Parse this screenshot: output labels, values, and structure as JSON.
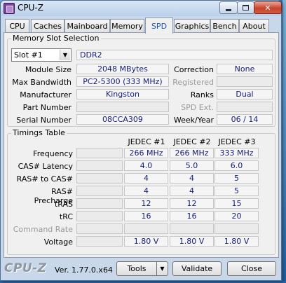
{
  "window": {
    "title": "CPU-Z"
  },
  "tabs": [
    {
      "label": "CPU"
    },
    {
      "label": "Caches"
    },
    {
      "label": "Mainboard"
    },
    {
      "label": "Memory"
    },
    {
      "label": "SPD"
    },
    {
      "label": "Graphics"
    },
    {
      "label": "Bench"
    },
    {
      "label": "About"
    }
  ],
  "active_tab": "SPD",
  "slot": {
    "group_title": "Memory Slot Selection",
    "selected": "Slot #1",
    "type": "DDR2",
    "labels": {
      "module_size": "Module Size",
      "max_bandwidth": "Max Bandwidth",
      "manufacturer": "Manufacturer",
      "part_number": "Part Number",
      "serial_number": "Serial Number",
      "correction": "Correction",
      "registered": "Registered",
      "ranks": "Ranks",
      "spd_ext": "SPD Ext.",
      "week_year": "Week/Year"
    },
    "values": {
      "module_size": "2048 MBytes",
      "max_bandwidth": "PC2-5300 (333 MHz)",
      "manufacturer": "Kingston",
      "part_number": "",
      "serial_number": "08CCA309",
      "correction": "None",
      "registered": "",
      "ranks": "Dual",
      "spd_ext": "",
      "week_year": "06 / 14"
    }
  },
  "timings": {
    "group_title": "Timings Table",
    "columns": [
      "JEDEC #1",
      "JEDEC #2",
      "JEDEC #3"
    ],
    "rows": [
      {
        "label": "Frequency",
        "values": [
          "266 MHz",
          "266 MHz",
          "333 MHz"
        ]
      },
      {
        "label": "CAS# Latency",
        "values": [
          "4.0",
          "5.0",
          "6.0"
        ]
      },
      {
        "label": "RAS# to CAS#",
        "values": [
          "4",
          "4",
          "5"
        ]
      },
      {
        "label": "RAS# Precharge",
        "values": [
          "4",
          "4",
          "5"
        ]
      },
      {
        "label": "tRAS",
        "values": [
          "12",
          "12",
          "15"
        ]
      },
      {
        "label": "tRC",
        "values": [
          "16",
          "16",
          "20"
        ]
      },
      {
        "label": "Command Rate",
        "values": [
          "",
          "",
          ""
        ]
      },
      {
        "label": "Voltage",
        "values": [
          "1.80 V",
          "1.80 V",
          "1.80 V"
        ]
      }
    ]
  },
  "footer": {
    "logo": "CPU-Z",
    "version": "Ver. 1.77.0.x64",
    "tools_label": "Tools",
    "validate_label": "Validate",
    "close_label": "Close"
  }
}
